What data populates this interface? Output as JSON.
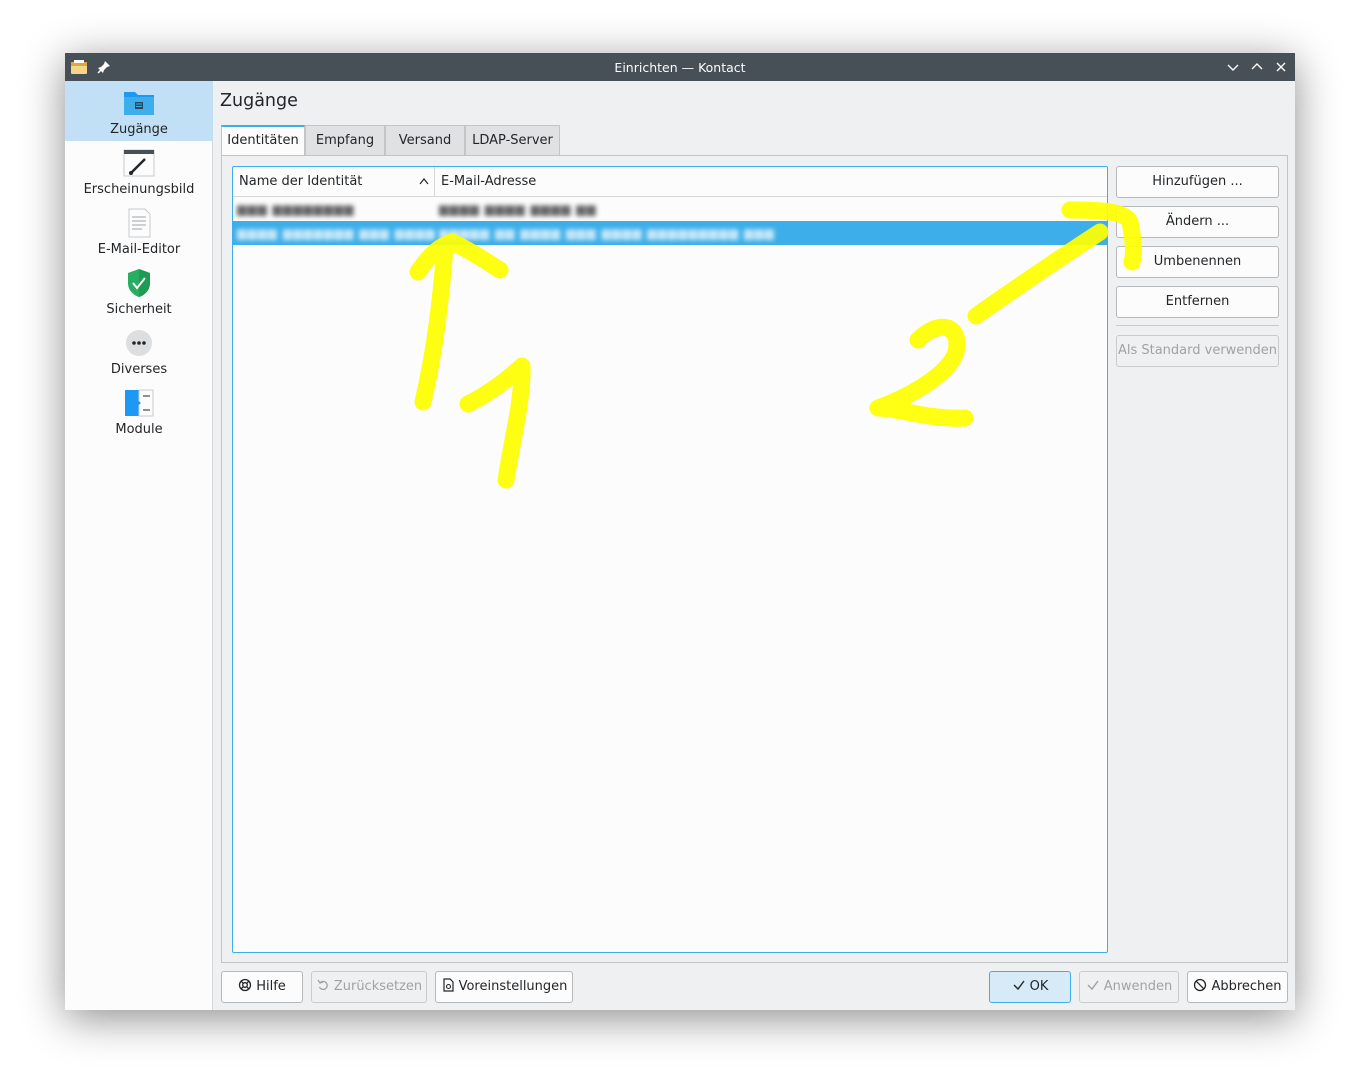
{
  "window": {
    "title": "Einrichten — Kontact"
  },
  "sidebar": {
    "items": [
      {
        "label": "Zugänge",
        "icon": "folder-accounts-icon",
        "active": true
      },
      {
        "label": "Erscheinungsbild",
        "icon": "appearance-brush-icon",
        "active": false
      },
      {
        "label": "E-Mail-Editor",
        "icon": "document-editor-icon",
        "active": false
      },
      {
        "label": "Sicherheit",
        "icon": "shield-check-icon",
        "active": false
      },
      {
        "label": "Diverses",
        "icon": "more-dots-icon",
        "active": false
      },
      {
        "label": "Module",
        "icon": "plugin-modules-icon",
        "active": false
      }
    ]
  },
  "page": {
    "title": "Zugänge"
  },
  "tabs": [
    {
      "label": "Identitäten",
      "active": true
    },
    {
      "label": "Empfang",
      "active": false
    },
    {
      "label": "Versand",
      "active": false
    },
    {
      "label": "LDAP-Server",
      "active": false
    }
  ],
  "identities": {
    "columns": [
      "Name der Identität",
      "E-Mail-Adresse"
    ],
    "rows": [
      {
        "name": "▆▆▆ ▆▆▆▆▆▆▆▆",
        "email": "▆▆▆▆ ▆▆▆▆ ▆▆▆▆ ▆▆",
        "selected": false
      },
      {
        "name": "▆▆▆▆ ▆▆▆▆▆▆▆ ▆▆▆ ▆▆▆▆▆▆▆▆▆▆",
        "email": "▆▆▆▆▆ ▆▆ ▆▆▆▆ ▆▆▆ ▆▆▆▆ ▆▆▆▆▆▆▆▆▆ ▆▆▆",
        "selected": true
      }
    ]
  },
  "side_buttons": {
    "add": "Hinzufügen ...",
    "edit": "Ändern ...",
    "rename": "Umbenennen",
    "remove": "Entfernen",
    "set_default": "Als Standard verwenden"
  },
  "footer": {
    "help": "Hilfe",
    "reset": "Zurücksetzen",
    "defaults": "Voreinstellungen",
    "ok": "OK",
    "apply": "Anwenden",
    "cancel": "Abbrechen"
  },
  "annotations": {
    "label_1": "1",
    "label_2": "2",
    "color": "#ffff00"
  },
  "colors": {
    "accent": "#3daee9",
    "titlebar": "#475057",
    "window_bg": "#eff0f1"
  }
}
